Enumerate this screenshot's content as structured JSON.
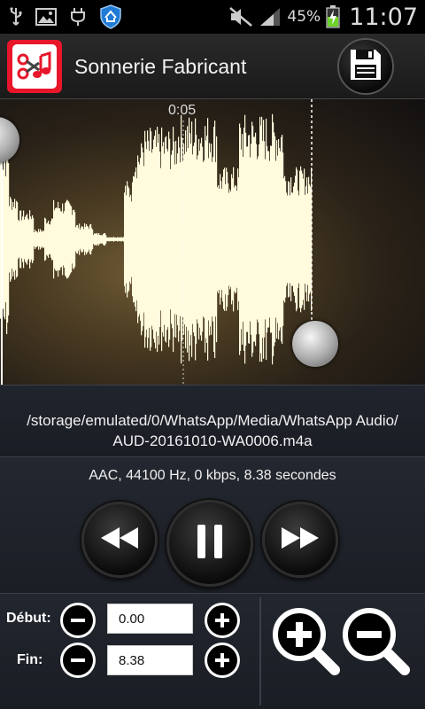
{
  "status_bar": {
    "battery_percent": "45%",
    "time": "11:07",
    "icons": [
      "usb-icon",
      "gallery-icon",
      "charging-plug-icon",
      "shield-icon",
      "mute-icon",
      "signal-icon",
      "battery-charging-icon"
    ]
  },
  "app": {
    "title": "Sonnerie Fabricant",
    "icon": "ringtone-maker-icon",
    "save_icon": "floppy-save-icon"
  },
  "waveform": {
    "time_marker": "0:05",
    "wave_color": "#fffbdc",
    "handle_color": "#cfcfcf"
  },
  "file": {
    "path_line1": "/storage/emulated/0/WhatsApp/Media/WhatsApp Audio/",
    "path_line2": "AUD-20161010-WA0006.m4a"
  },
  "info": {
    "text": "AAC, 44100 Hz, 0 kbps, 8.38 secondes"
  },
  "transport": {
    "rewind_icon": "rewind-icon",
    "pause_icon": "pause-icon",
    "forward_icon": "fast-forward-icon"
  },
  "trim": {
    "start_label": "Début:",
    "start_value": "0.00",
    "end_label": "Fin:",
    "end_value": "8.38"
  },
  "zoom": {
    "zoom_in_icon": "zoom-in-icon",
    "zoom_out_icon": "zoom-out-icon"
  }
}
